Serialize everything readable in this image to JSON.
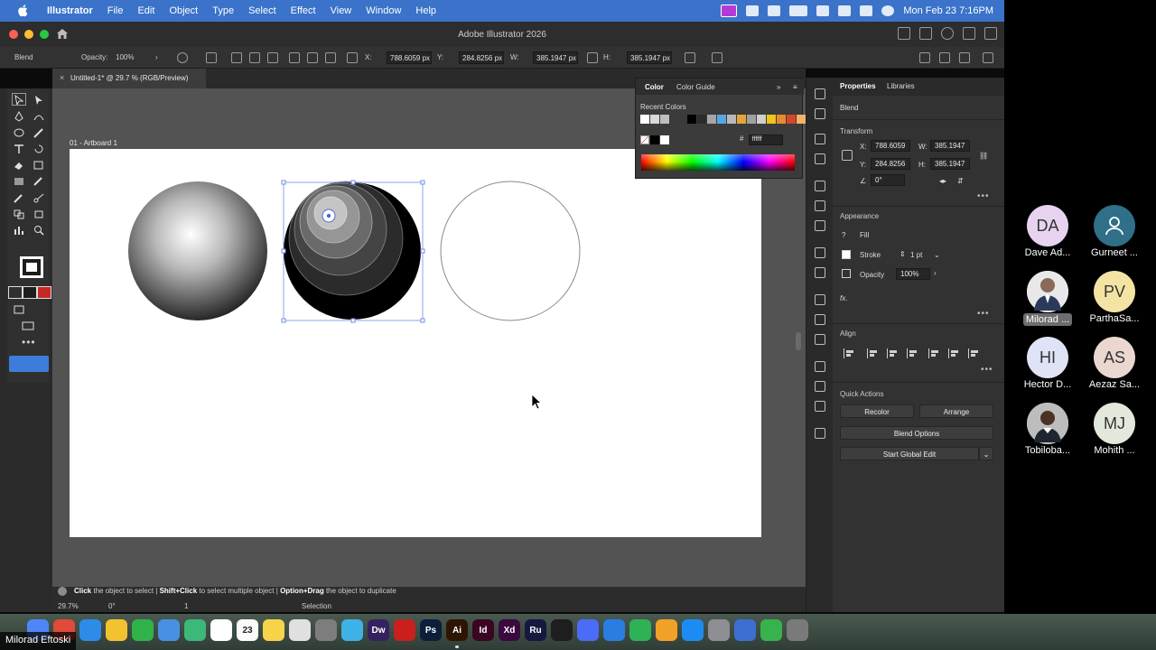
{
  "menubar": {
    "app_name": "Illustrator",
    "items": [
      "File",
      "Edit",
      "Object",
      "Type",
      "Select",
      "Effect",
      "View",
      "Window",
      "Help"
    ],
    "clock": "Mon Feb 23  7:16PM"
  },
  "window": {
    "title": "Adobe Illustrator 2026"
  },
  "controlbar": {
    "selection_type": "Blend",
    "opacity_label": "Opacity:",
    "opacity_value": "100%",
    "x_label": "X:",
    "x_value": "788.6059 px",
    "y_label": "Y:",
    "y_value": "284.8256 px",
    "w_label": "W:",
    "w_value": "385.1947 px",
    "h_label": "H:",
    "h_value": "385.1947 px"
  },
  "document": {
    "tab_title": "Untitled-1* @ 29.7 % (RGB/Preview)",
    "tab_close": "×",
    "artboard_label": "01 - Artboard 1"
  },
  "color_panel": {
    "tabs": [
      "Color",
      "Color Guide"
    ],
    "recent_label": "Recent Colors",
    "recent_colors": [
      "#ffffff",
      "#d9d9d9",
      "#bfbfbf",
      "#3a3a3a",
      "#000000",
      "#2b2b2b",
      "#a6a6a6",
      "#57a8e0",
      "#b9b9b9",
      "#e5a53a",
      "#a0a0a0",
      "#cfcfcf",
      "#f0c419",
      "#e88b2d",
      "#d5462b",
      "#f3b26a"
    ],
    "hash": "#",
    "hex_value": "ffffff"
  },
  "properties": {
    "tabs": [
      "Properties",
      "Libraries"
    ],
    "object_type": "Blend",
    "transform_label": "Transform",
    "x_label": "X:",
    "x_value": "788.6059",
    "y_label": "Y:",
    "y_value": "284.8256",
    "w_label": "W:",
    "w_value": "385.1947",
    "h_label": "H:",
    "h_value": "385.1947",
    "angle_value": "0°",
    "appearance_label": "Appearance",
    "fill_label": "Fill",
    "stroke_label": "Stroke",
    "stroke_value": "1 pt",
    "opacity_label": "Opacity",
    "opacity_value": "100%",
    "fx_label": "fx.",
    "align_label": "Align",
    "quick_actions_label": "Quick Actions",
    "recolor_button": "Recolor",
    "arrange_button": "Arrange",
    "blend_options_button": "Blend Options",
    "global_edit_button": "Start Global Edit"
  },
  "statusbar": {
    "hint_parts": [
      "Click",
      " the object to select  |  ",
      "Shift+Click",
      " to select multiple object  |  ",
      "Option+Drag",
      " the object to duplicate"
    ],
    "zoom": "29.7%",
    "rotation": "0°",
    "artboard_num": "1",
    "tool_name": "Selection"
  },
  "participants": [
    {
      "initials": "DA",
      "name": "Dave Ad...",
      "color": "#e7d3ef"
    },
    {
      "initials": "",
      "name": "Gurneet ...",
      "color": "#2f6f87"
    },
    {
      "initials": "",
      "name": "Milorad ...",
      "color": "#dcdcdc"
    },
    {
      "initials": "PV",
      "name": "ParthaSa...",
      "color": "#f4e4a3"
    },
    {
      "initials": "HI",
      "name": "Hector D...",
      "color": "#dfe3f5"
    },
    {
      "initials": "AS",
      "name": "Aezaz Sa...",
      "color": "#ead8d0"
    },
    {
      "initials": "",
      "name": "Tobiloba...",
      "color": "#c8c8c8"
    },
    {
      "initials": "MJ",
      "name": "Mohith ...",
      "color": "#e3e8dc"
    }
  ],
  "dock": {
    "calendar_day": "23",
    "apps": [
      {
        "label": "",
        "color": "#4f86f7"
      },
      {
        "label": "",
        "color": "#e04a3a"
      },
      {
        "label": "",
        "color": "#2e8be8"
      },
      {
        "label": "",
        "color": "#f2c230"
      },
      {
        "label": "",
        "color": "#32b24a"
      },
      {
        "label": "",
        "color": "#4a90e2"
      },
      {
        "label": "",
        "color": "#3cb878"
      },
      {
        "label": "",
        "color": "#ffffff"
      },
      {
        "label": "",
        "color": "#fafafa"
      },
      {
        "label": "",
        "color": "#f7d34a"
      },
      {
        "label": "",
        "color": "#e0e0e0"
      },
      {
        "label": "",
        "color": "#7d7d7d"
      },
      {
        "label": "",
        "color": "#3eb1e6"
      },
      {
        "label": "Dw",
        "color": "#35215f"
      },
      {
        "label": "",
        "color": "#c9201d"
      },
      {
        "label": "Ps",
        "color": "#0d1e3a"
      },
      {
        "label": "Ai",
        "color": "#2e1502"
      },
      {
        "label": "Id",
        "color": "#3b0622"
      },
      {
        "label": "Xd",
        "color": "#3a0a3f"
      },
      {
        "label": "Ru",
        "color": "#16183f"
      },
      {
        "label": "",
        "color": "#1e1e1e"
      },
      {
        "label": "",
        "color": "#4a6cf7"
      },
      {
        "label": "",
        "color": "#2a7de1"
      },
      {
        "label": "",
        "color": "#2fb156"
      },
      {
        "label": "",
        "color": "#f2a127"
      },
      {
        "label": "",
        "color": "#1d8cf2"
      },
      {
        "label": "",
        "color": "#8e8e93"
      },
      {
        "label": "",
        "color": "#3c6fd1"
      },
      {
        "label": "",
        "color": "#37b24d"
      },
      {
        "label": "",
        "color": "#7a7a7a"
      }
    ]
  },
  "presenter_name": "Milorad Eftoski"
}
